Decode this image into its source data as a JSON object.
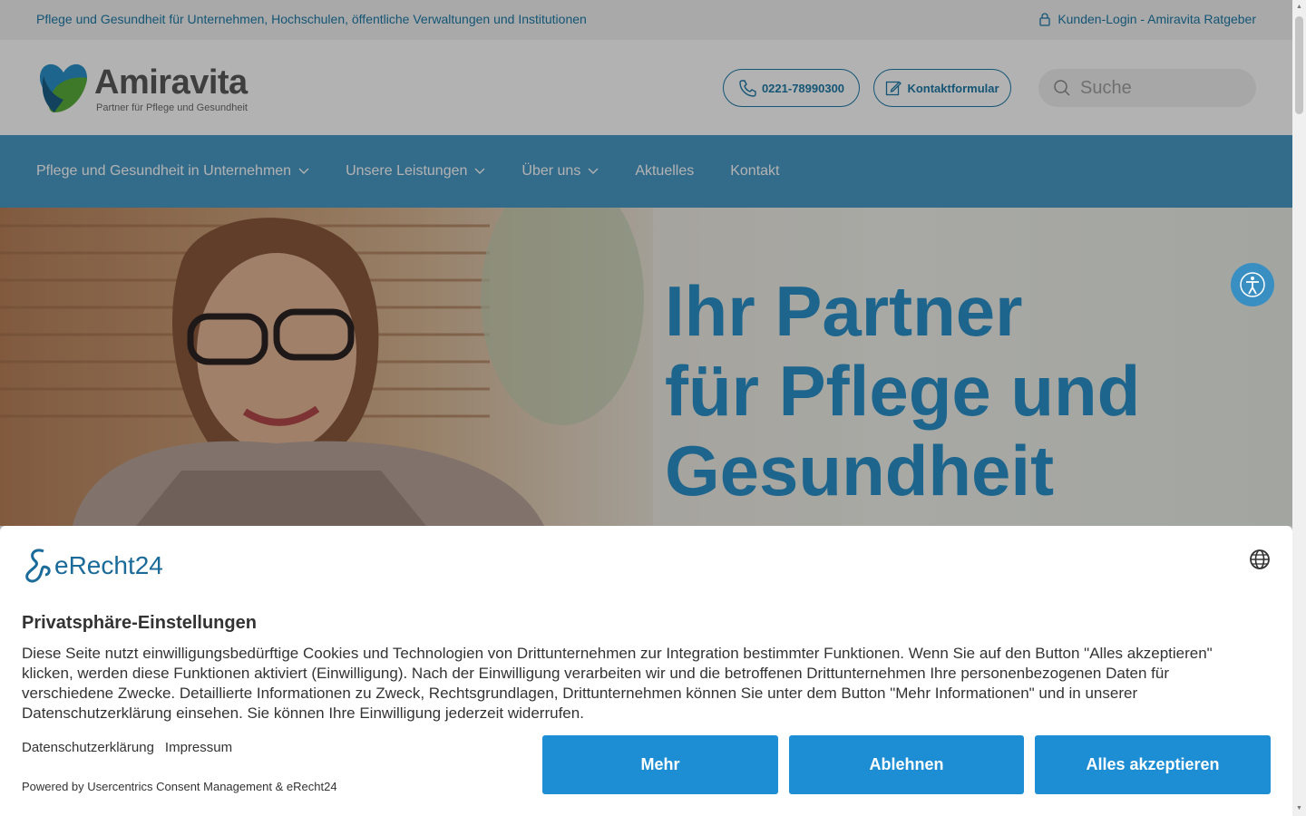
{
  "topbar": {
    "tagline": "Pflege und Gesundheit für Unternehmen, Hochschulen, öffentliche Verwaltungen und Institutionen",
    "login_link": "Kunden-Login - Amiravita Ratgeber",
    "login_icon": "lock-icon"
  },
  "header": {
    "logo_title": "Amiravita",
    "logo_subtitle": "Partner für Pflege und Gesundheit",
    "phone_label": "0221-78990300",
    "contact_label": "Kontaktformular",
    "search_placeholder": "Suche"
  },
  "nav": {
    "items": [
      {
        "label": "Pflege und Gesundheit in Unternehmen",
        "has_dropdown": true
      },
      {
        "label": "Unsere Leistungen",
        "has_dropdown": true
      },
      {
        "label": "Über uns",
        "has_dropdown": true
      },
      {
        "label": "Aktuelles",
        "has_dropdown": false
      },
      {
        "label": "Kontakt",
        "has_dropdown": false
      }
    ]
  },
  "hero": {
    "title_line1": "Ihr Partner",
    "title_line2": "für Pflege und",
    "title_line3": "Gesundheit"
  },
  "consent": {
    "brand": "eRecht24",
    "title": "Privatsphäre-Einstellungen",
    "body": "Diese Seite nutzt einwilligungsbedürftige Cookies und Technologien von Drittunternehmen zur Integration bestimmter Funktionen. Wenn Sie auf den Button \"Alles akzeptieren\" klicken, werden diese Funktionen aktiviert (Einwilligung). Nach der Einwilligung verarbeiten wir und die betroffenen Drittunternehmen Ihre personenbezogenen Daten für verschiedene Zwecke. Detaillierte Informationen zu Zweck, Rechtsgrundlagen, Drittunternehmen können Sie unter dem Button \"Mehr Informationen\" und in unserer Datenschutzerklärung einsehen. Sie können Ihre Einwilligung jederzeit widerrufen.",
    "link_privacy": "Datenschutzerklärung",
    "link_imprint": "Impressum",
    "powered_by": "Powered by Usercentrics Consent Management & eRecht24",
    "btn_more": "Mehr",
    "btn_reject": "Ablehnen",
    "btn_accept": "Alles akzeptieren"
  },
  "colors": {
    "brand_blue": "#1d7aa8",
    "nav_blue": "#4a9ac7",
    "button_blue": "#1e8ed4",
    "hero_title": "#2a91c9"
  }
}
